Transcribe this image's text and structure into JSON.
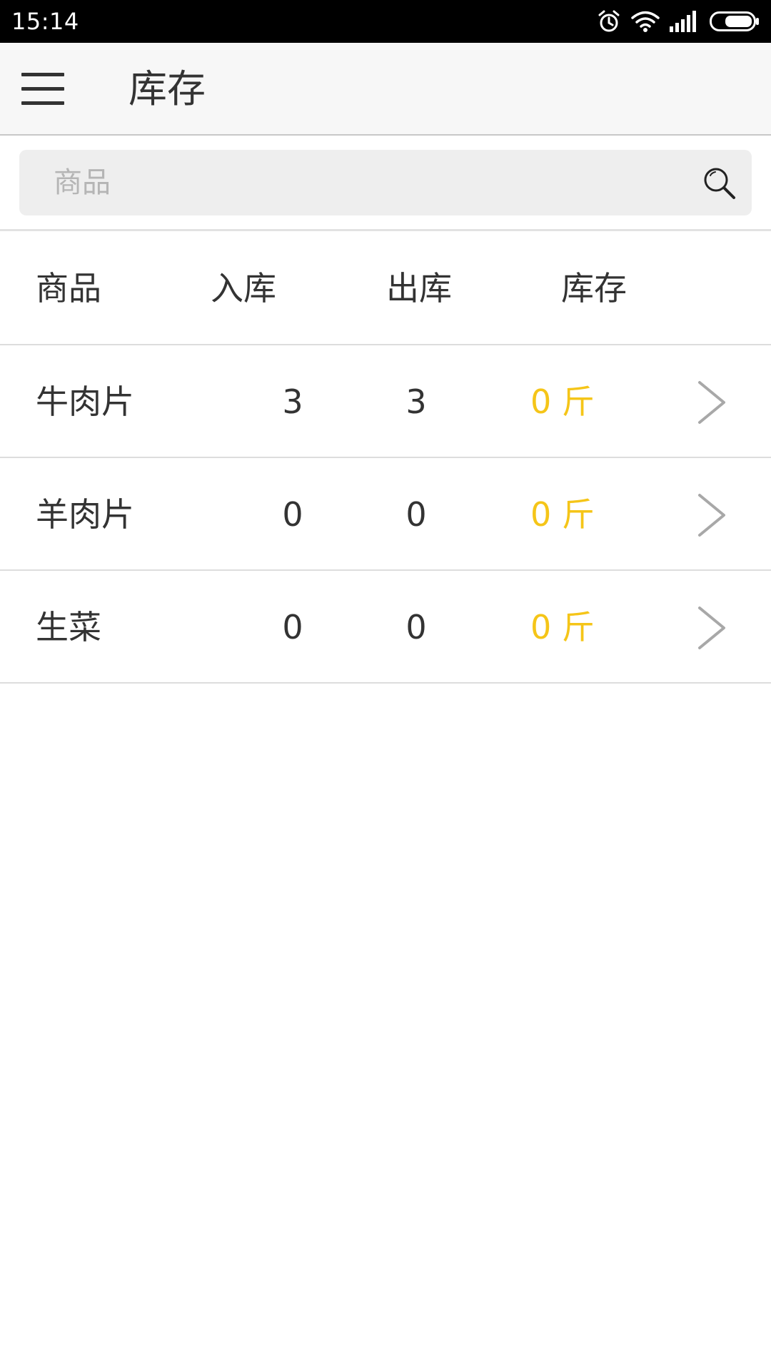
{
  "status_bar": {
    "time": "15:14",
    "icons": [
      "alarm-icon",
      "wifi-icon",
      "signal-icon",
      "battery-icon"
    ]
  },
  "app_bar": {
    "menu_icon": "hamburger-menu-icon",
    "title": "库存"
  },
  "search": {
    "placeholder": "商品",
    "value": "",
    "icon": "search-icon"
  },
  "table": {
    "headers": {
      "product": "商品",
      "in": "入库",
      "out": "出库",
      "stock": "库存"
    },
    "rows": [
      {
        "name": "牛肉片",
        "in": "3",
        "out": "3",
        "stock": "0 斤"
      },
      {
        "name": "羊肉片",
        "in": "0",
        "out": "0",
        "stock": "0 斤"
      },
      {
        "name": "生菜",
        "in": "0",
        "out": "0",
        "stock": "0 斤"
      }
    ]
  },
  "colors": {
    "stock_accent": "#f5c518",
    "text": "#333333",
    "status_bar": "#000000",
    "app_bar": "#f7f7f7"
  }
}
